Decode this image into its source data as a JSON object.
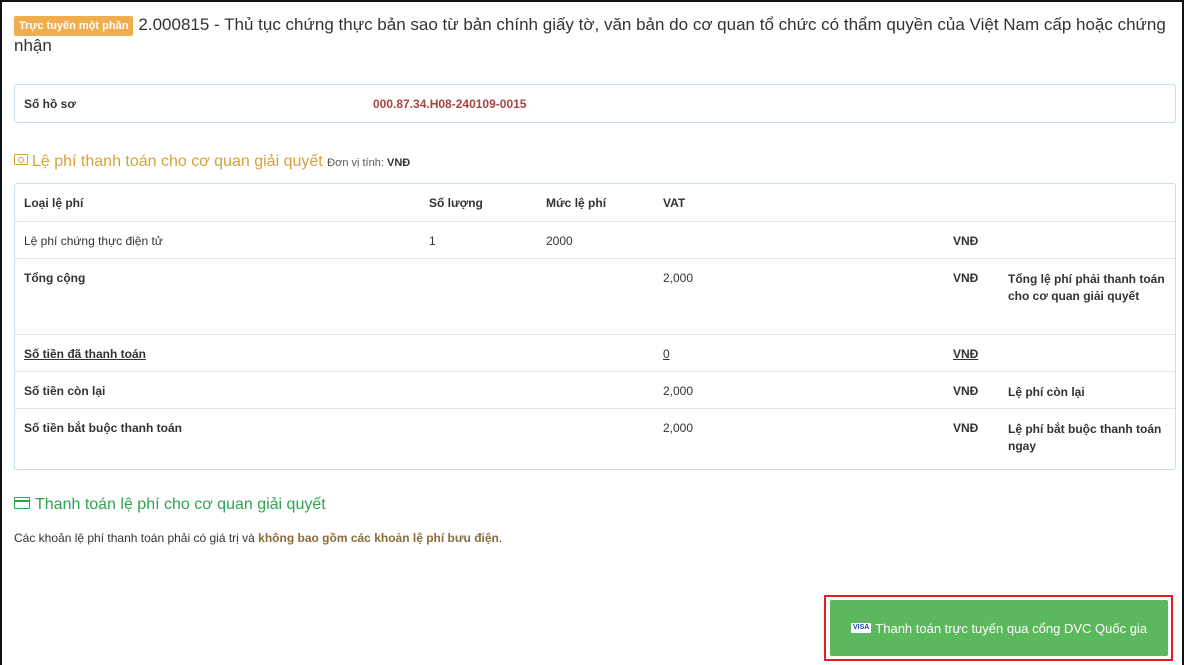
{
  "header": {
    "badge": "Trực tuyến một phần",
    "title": "2.000815 - Thủ tục chứng thực bản sao từ bản chính giấy tờ, văn bản do cơ quan tổ chức có thẩm quyền của Việt Nam cấp hoặc chứng nhận"
  },
  "file": {
    "label": "Số hồ sơ",
    "value": "000.87.34.H08-240109-0015"
  },
  "fee_section": {
    "title": "Lệ phí thanh toán cho cơ quan giải quyết",
    "unit_label": "Đơn vị tính:",
    "unit_value": "VNĐ",
    "icon": "money-icon",
    "columns": [
      "Loại lệ phí",
      "Số lượng",
      "Mức lệ phí",
      "VAT"
    ],
    "rows": [
      {
        "name": "Lệ phí chứng thực điện tử",
        "qty": "1",
        "fee": "2000",
        "vat": "",
        "currency": "VNĐ",
        "note": ""
      },
      {
        "name": "Tổng cộng",
        "qty": "",
        "fee": "",
        "vat": "2,000",
        "currency": "VNĐ",
        "note": "Tổng lệ phí phải thanh toán cho cơ quan giải quyết"
      },
      {
        "name": "Số tiền đã thanh toán",
        "qty": "",
        "fee": "",
        "vat": "0",
        "currency": "VNĐ",
        "note": ""
      },
      {
        "name": "Số tiền còn lại",
        "qty": "",
        "fee": "",
        "vat": "2,000",
        "currency": "VNĐ",
        "note": "Lệ phí còn lại"
      },
      {
        "name": "Số tiền bắt buộc thanh toán",
        "qty": "",
        "fee": "",
        "vat": "2,000",
        "currency": "VNĐ",
        "note": "Lệ phí bắt buộc thanh toán ngay"
      }
    ]
  },
  "payment": {
    "title": "Thanh toán lệ phí cho cơ quan giải quyết",
    "icon": "credit-card-icon",
    "desc_prefix": "Các khoản lệ phí thanh toán phải có giá trị và",
    "desc_bold": "không bao gồm các khoản lệ phí bưu điện",
    "desc_suffix": ".",
    "button_label": "Thanh toán trực tuyến qua cổng DVC Quốc gia",
    "button_icon_text": "VISA"
  },
  "colors": {
    "badge": "#f0ad4e",
    "fee_title": "#d4a33a",
    "file_number": "#a94442",
    "payment_title": "#2ea44f",
    "button": "#5cb85c",
    "highlight_border": "#e02020"
  }
}
